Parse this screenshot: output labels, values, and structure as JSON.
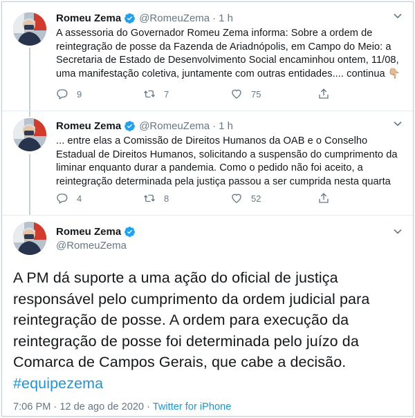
{
  "colors": {
    "accent": "#1da1f2",
    "link": "#1b95e0",
    "muted": "#657786",
    "text": "#14171a"
  },
  "tweets": [
    {
      "name": "Romeu Zema",
      "handle": "@RomeuZema",
      "separator": "·",
      "time": "1 h",
      "text": "A assessoria do Governador Romeu Zema informa: Sobre a ordem de reintegração de posse da Fazenda de Ariadnópolis, em Campo do Meio: a Secretaria de Estado de Desenvolvimento Social encaminhou ontem, 11/08, uma manifestação coletiva, juntamente com outras entidades.... continua 👇🏼",
      "replies": "9",
      "retweets": "7",
      "likes": "75"
    },
    {
      "name": "Romeu Zema",
      "handle": "@RomeuZema",
      "separator": "·",
      "time": "1 h",
      "text": "... entre elas a Comissão de Direitos Humanos da OAB e o Conselho Estadual de Direitos Humanos, solicitando a suspensão do cumprimento da liminar enquanto durar a pandemia. Como o pedido não foi aceito, a reintegração determinada pela justiça passou a ser cumprida nesta quarta",
      "replies": "4",
      "retweets": "8",
      "likes": "52"
    }
  ],
  "main_tweet": {
    "name": "Romeu Zema",
    "handle": "@RomeuZema",
    "text": "A PM dá suporte a uma ação do oficial de justiça responsável pelo cumprimento da ordem judicial para reintegração de posse. A ordem para execução da reintegração de posse foi determinada pelo juízo da Comarca de Campos Gerais, que cabe a decisão.",
    "hashtag": "#equipezema",
    "timestamp": "7:06 PM · 12 de ago de 2020 · ",
    "source": "Twitter for iPhone"
  },
  "icons": [
    "verified-icon",
    "chevron-down-icon",
    "reply-icon",
    "retweet-icon",
    "like-icon",
    "share-icon"
  ]
}
